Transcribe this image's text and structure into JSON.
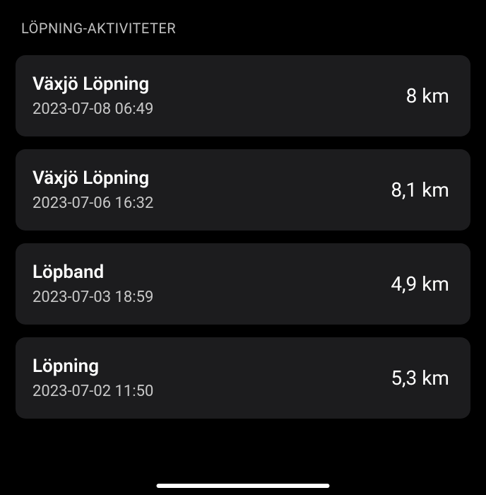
{
  "section": {
    "title": "LÖPNING-AKTIVITETER"
  },
  "activities": [
    {
      "title": "Växjö Löpning",
      "date": "2023-07-08 06:49",
      "distance": "8 km"
    },
    {
      "title": "Växjö Löpning",
      "date": "2023-07-06 16:32",
      "distance": "8,1 km"
    },
    {
      "title": "Löpband",
      "date": "2023-07-03 18:59",
      "distance": "4,9 km"
    },
    {
      "title": "Löpning",
      "date": "2023-07-02 11:50",
      "distance": "5,3 km"
    }
  ]
}
